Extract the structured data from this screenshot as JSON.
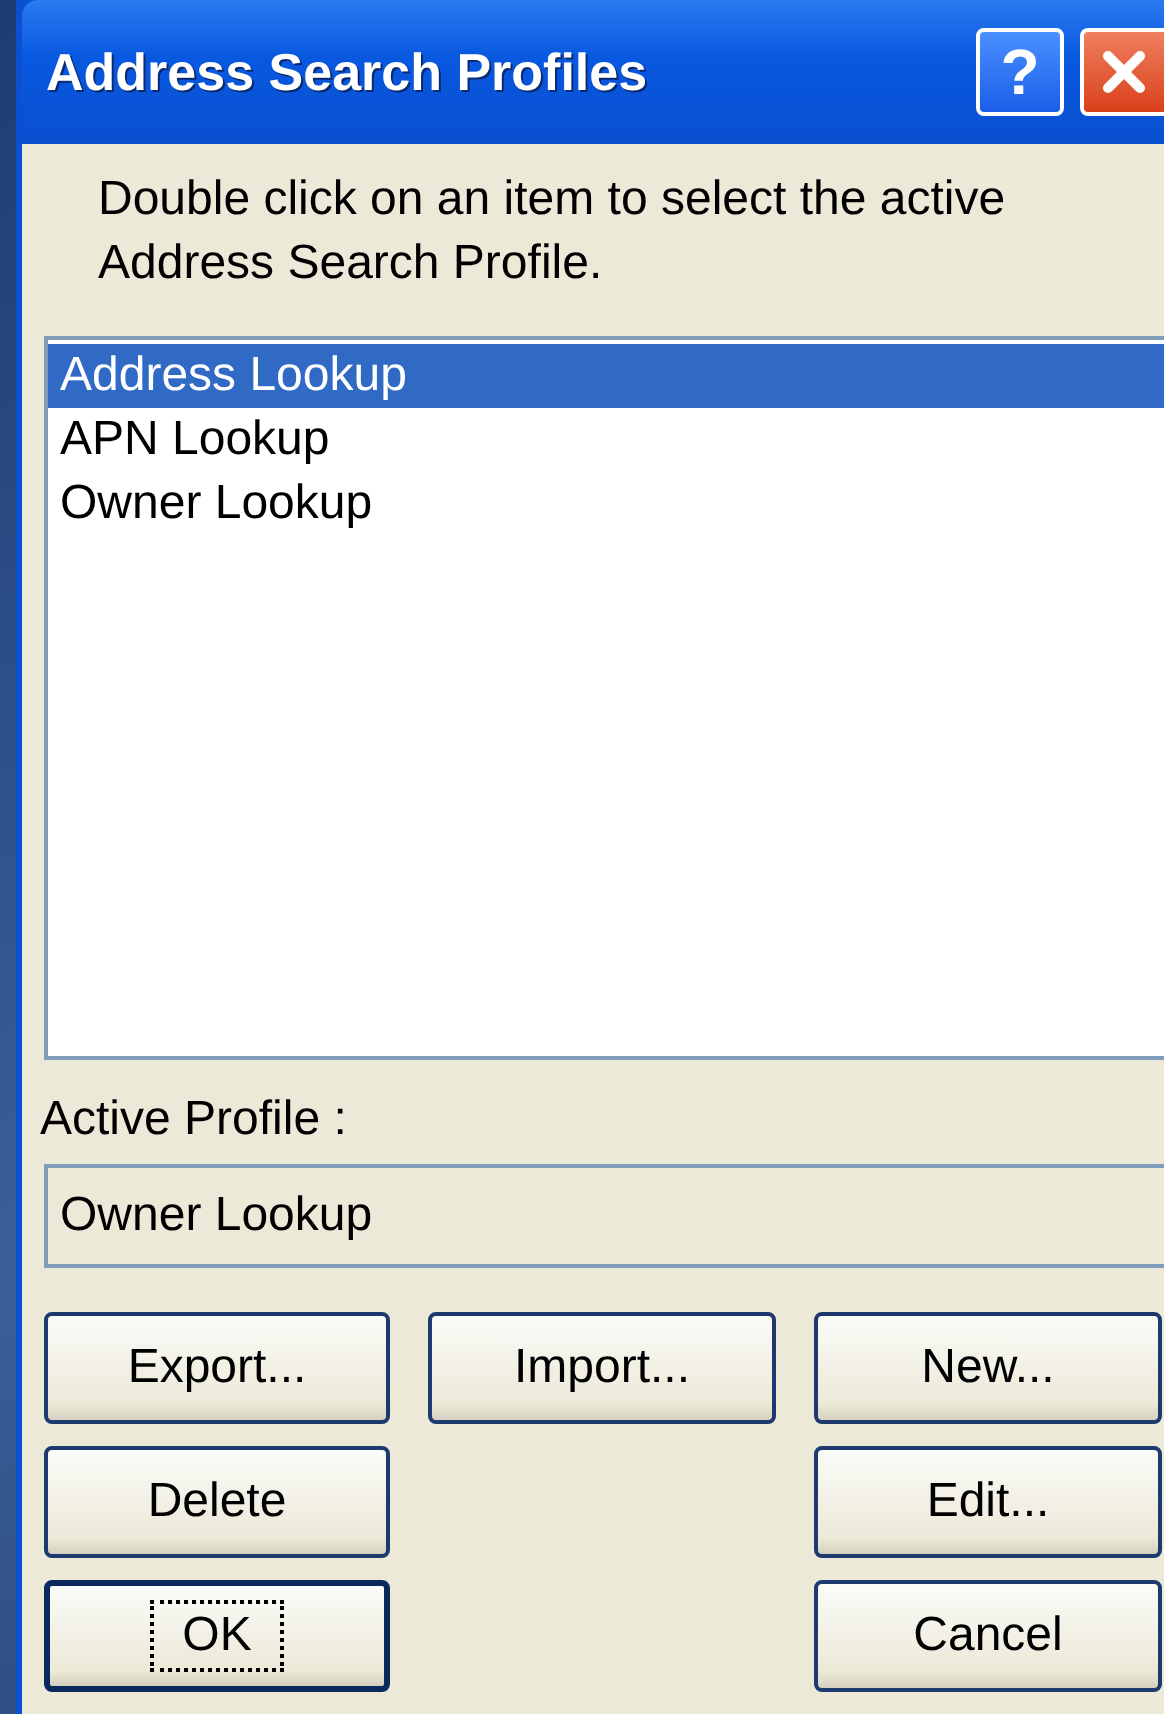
{
  "window": {
    "title": "Address Search Profiles"
  },
  "title_buttons": [
    {
      "kind": "help",
      "label": "?"
    },
    {
      "kind": "close"
    }
  ],
  "instruction": "Double click on an item to select the active Address Search Profile.",
  "profiles": [
    {
      "label": "Address Lookup",
      "selected": true
    },
    {
      "label": "APN Lookup",
      "selected": false
    },
    {
      "label": "Owner Lookup",
      "selected": false
    }
  ],
  "active_profile": {
    "label": "Active Profile :",
    "value": "Owner Lookup"
  },
  "button_rows": [
    {
      "left": {
        "label": "Export...",
        "focused": false
      },
      "middle": {
        "label": "Import...",
        "focused": false
      },
      "right": {
        "label": "New...",
        "focused": false
      }
    },
    {
      "left": {
        "label": "Delete",
        "focused": false
      },
      "right": {
        "label": "Edit...",
        "focused": false
      }
    },
    {
      "left": {
        "label": "OK",
        "focused": true
      },
      "right": {
        "label": "Cancel",
        "focused": false
      }
    }
  ]
}
